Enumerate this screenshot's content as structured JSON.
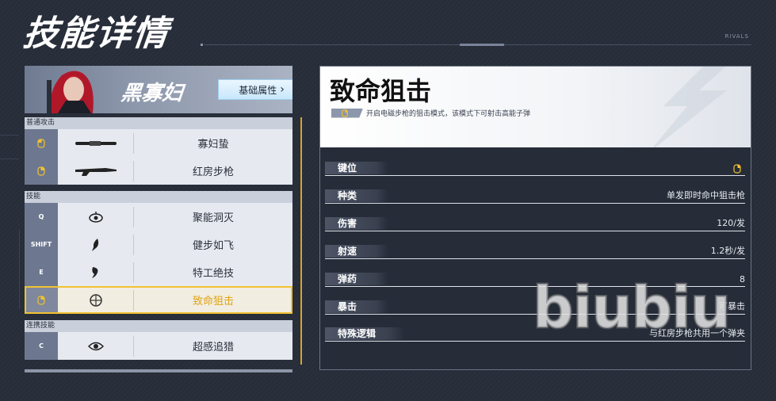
{
  "page": {
    "title": "技能详情",
    "brand": "RIVALS"
  },
  "hero": {
    "name": "黑寡妇",
    "attributes_button": "基础属性",
    "chevron": "›"
  },
  "sections": [
    {
      "header": "普通攻击",
      "skills": [
        {
          "key": "",
          "key_icon": "mouse-left-icon",
          "icon": "baton-icon",
          "name": "寡妇蛰"
        },
        {
          "key": "",
          "key_icon": "mouse-right-icon",
          "icon": "rifle-icon",
          "name": "红房步枪"
        }
      ]
    },
    {
      "header": "技能",
      "skills": [
        {
          "key": "Q",
          "key_icon": "",
          "icon": "eye-drone-icon",
          "name": "聚能洞灭"
        },
        {
          "key": "SHIFT",
          "key_icon": "",
          "icon": "leap-icon",
          "name": "健步如飞"
        },
        {
          "key": "E",
          "key_icon": "",
          "icon": "kick-icon",
          "name": "特工绝技"
        },
        {
          "key": "",
          "key_icon": "mouse-right-icon",
          "icon": "crosshair-icon",
          "name": "致命狙击",
          "active": true
        }
      ]
    },
    {
      "header": "连携技能",
      "skills": [
        {
          "key": "C",
          "key_icon": "",
          "icon": "sense-eye-icon",
          "name": "超感追猎"
        }
      ]
    }
  ],
  "detail": {
    "title": "致命狙击",
    "description": "开启电磁步枪的狙击模式，该模式下可射击高能子弹",
    "stats": [
      {
        "label": "键位",
        "value": "",
        "value_icon": "mouse-right-icon"
      },
      {
        "label": "种类",
        "value": "单发即时命中狙击枪"
      },
      {
        "label": "伤害",
        "value": "120/发"
      },
      {
        "label": "射速",
        "value": "1.2秒/发"
      },
      {
        "label": "弹药",
        "value": "8"
      },
      {
        "label": "暴击",
        "value": "可暴击"
      },
      {
        "label": "特殊逻辑",
        "value": "与红房步枪共用一个弹夹"
      }
    ]
  },
  "watermark": "biubiu",
  "colors": {
    "accent_gold": "#f1c232",
    "active_text": "#e0a416",
    "attr_button": "#c9e7fb"
  }
}
